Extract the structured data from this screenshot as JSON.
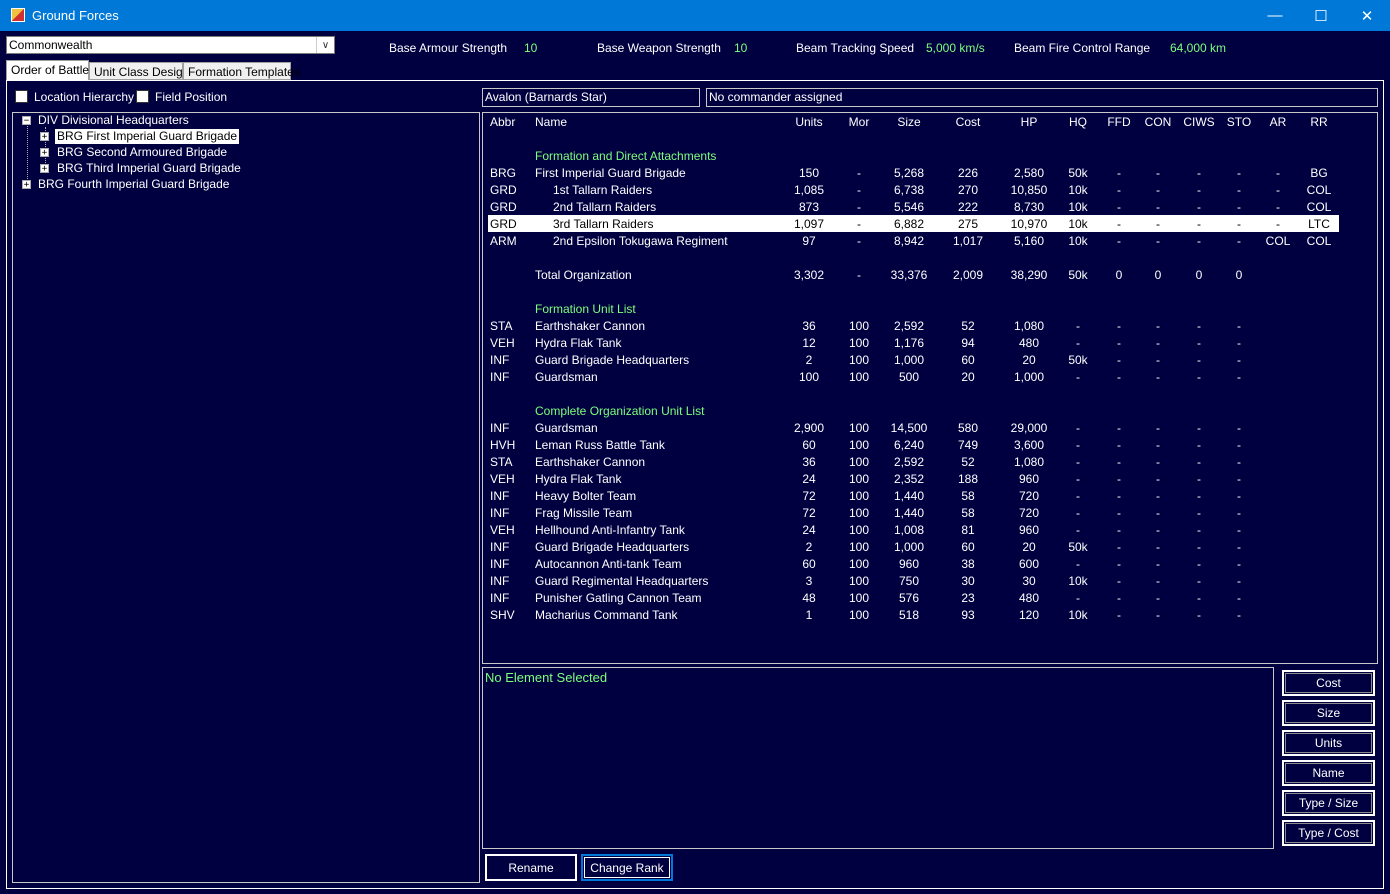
{
  "window": {
    "title": "Ground Forces"
  },
  "race_select": {
    "value": "Commonwealth"
  },
  "stats": [
    {
      "label": "Base Armour Strength",
      "value": "10"
    },
    {
      "label": "Base Weapon Strength",
      "value": "10"
    },
    {
      "label": "Beam Tracking Speed",
      "value": "5,000 km/s"
    },
    {
      "label": "Beam Fire Control Range",
      "value": "64,000 km"
    }
  ],
  "tabs": [
    "Order of Battle",
    "Unit Class Design",
    "Formation Templates"
  ],
  "checkboxes": {
    "location_hierarchy": "Location Hierarchy",
    "field_position": "Field Position"
  },
  "tree": [
    "DIV Divisional Headquarters",
    "BRG First Imperial Guard Brigade",
    "BRG Second Armoured Brigade",
    "BRG Third Imperial Guard Brigade",
    "BRG Fourth Imperial Guard Brigade"
  ],
  "location": "Avalon  (Barnards Star)",
  "commander": "No commander assigned",
  "columns": [
    "Abbr",
    "Name",
    "Units",
    "Mor",
    "Size",
    "Cost",
    "HP",
    "HQ",
    "FFD",
    "CON",
    "CIWS",
    "STO",
    "AR",
    "RR"
  ],
  "sections": {
    "formation": "Formation and Direct Attachments",
    "total_label": "Total Organization",
    "unit_list": "Formation Unit List",
    "complete": "Complete Organization Unit List"
  },
  "formation_rows": [
    [
      "BRG",
      "First Imperial Guard Brigade",
      "150",
      "-",
      "5,268",
      "226",
      "2,580",
      "50k",
      "-",
      "-",
      "-",
      "-",
      "-",
      "BG"
    ],
    [
      "GRD",
      "1st Tallarn Raiders",
      "1,085",
      "-",
      "6,738",
      "270",
      "10,850",
      "10k",
      "-",
      "-",
      "-",
      "-",
      "-",
      "COL"
    ],
    [
      "GRD",
      "2nd Tallarn Raiders",
      "873",
      "-",
      "5,546",
      "222",
      "8,730",
      "10k",
      "-",
      "-",
      "-",
      "-",
      "-",
      "COL"
    ],
    [
      "GRD",
      "3rd Tallarn Raiders",
      "1,097",
      "-",
      "6,882",
      "275",
      "10,970",
      "10k",
      "-",
      "-",
      "-",
      "-",
      "-",
      "LTC"
    ],
    [
      "ARM",
      "2nd Epsilon Tokugawa Regiment",
      "97",
      "-",
      "8,942",
      "1,017",
      "5,160",
      "10k",
      "-",
      "-",
      "-",
      "-",
      "COL",
      "COL"
    ]
  ],
  "total_row": [
    "",
    "Total Organization",
    "3,302",
    "-",
    "33,376",
    "2,009",
    "38,290",
    "50k",
    "0",
    "0",
    "0",
    "0",
    "",
    ""
  ],
  "unit_rows": [
    [
      "STA",
      "Earthshaker Cannon",
      "36",
      "100",
      "2,592",
      "52",
      "1,080",
      "-",
      "-",
      "-",
      "-",
      "-",
      "",
      ""
    ],
    [
      "VEH",
      "Hydra Flak Tank",
      "12",
      "100",
      "1,176",
      "94",
      "480",
      "-",
      "-",
      "-",
      "-",
      "-",
      "",
      ""
    ],
    [
      "INF",
      "Guard Brigade Headquarters",
      "2",
      "100",
      "1,000",
      "60",
      "20",
      "50k",
      "-",
      "-",
      "-",
      "-",
      "",
      ""
    ],
    [
      "INF",
      "Guardsman",
      "100",
      "100",
      "500",
      "20",
      "1,000",
      "-",
      "-",
      "-",
      "-",
      "-",
      "",
      ""
    ]
  ],
  "complete_rows": [
    [
      "INF",
      "Guardsman",
      "2,900",
      "100",
      "14,500",
      "580",
      "29,000",
      "-",
      "-",
      "-",
      "-",
      "-",
      "",
      ""
    ],
    [
      "HVH",
      "Leman Russ Battle Tank",
      "60",
      "100",
      "6,240",
      "749",
      "3,600",
      "-",
      "-",
      "-",
      "-",
      "-",
      "",
      ""
    ],
    [
      "STA",
      "Earthshaker Cannon",
      "36",
      "100",
      "2,592",
      "52",
      "1,080",
      "-",
      "-",
      "-",
      "-",
      "-",
      "",
      ""
    ],
    [
      "VEH",
      "Hydra Flak Tank",
      "24",
      "100",
      "2,352",
      "188",
      "960",
      "-",
      "-",
      "-",
      "-",
      "-",
      "",
      ""
    ],
    [
      "INF",
      "Heavy Bolter Team",
      "72",
      "100",
      "1,440",
      "58",
      "720",
      "-",
      "-",
      "-",
      "-",
      "-",
      "",
      ""
    ],
    [
      "INF",
      "Frag Missile Team",
      "72",
      "100",
      "1,440",
      "58",
      "720",
      "-",
      "-",
      "-",
      "-",
      "-",
      "",
      ""
    ],
    [
      "VEH",
      "Hellhound Anti-Infantry Tank",
      "24",
      "100",
      "1,008",
      "81",
      "960",
      "-",
      "-",
      "-",
      "-",
      "-",
      "",
      ""
    ],
    [
      "INF",
      "Guard Brigade Headquarters",
      "2",
      "100",
      "1,000",
      "60",
      "20",
      "50k",
      "-",
      "-",
      "-",
      "-",
      "",
      ""
    ],
    [
      "INF",
      "Autocannon Anti-tank Team",
      "60",
      "100",
      "960",
      "38",
      "600",
      "-",
      "-",
      "-",
      "-",
      "-",
      "",
      ""
    ],
    [
      "INF",
      "Guard Regimental Headquarters",
      "3",
      "100",
      "750",
      "30",
      "30",
      "10k",
      "-",
      "-",
      "-",
      "-",
      "",
      ""
    ],
    [
      "INF",
      "Punisher Gatling Cannon Team",
      "48",
      "100",
      "576",
      "23",
      "480",
      "-",
      "-",
      "-",
      "-",
      "-",
      "",
      ""
    ],
    [
      "SHV",
      "Macharius Command Tank",
      "1",
      "100",
      "518",
      "93",
      "120",
      "10k",
      "-",
      "-",
      "-",
      "-",
      "",
      ""
    ]
  ],
  "detail": {
    "message": "No Element Selected"
  },
  "sort_buttons": [
    "Cost",
    "Size",
    "Units",
    "Name",
    "Type / Size",
    "Type / Cost"
  ],
  "actions": {
    "rename": "Rename",
    "change_rank": "Change Rank"
  },
  "colors": {
    "background": "#000040",
    "accent_green": "#7cff7c",
    "titlebar": "#0078d7"
  }
}
